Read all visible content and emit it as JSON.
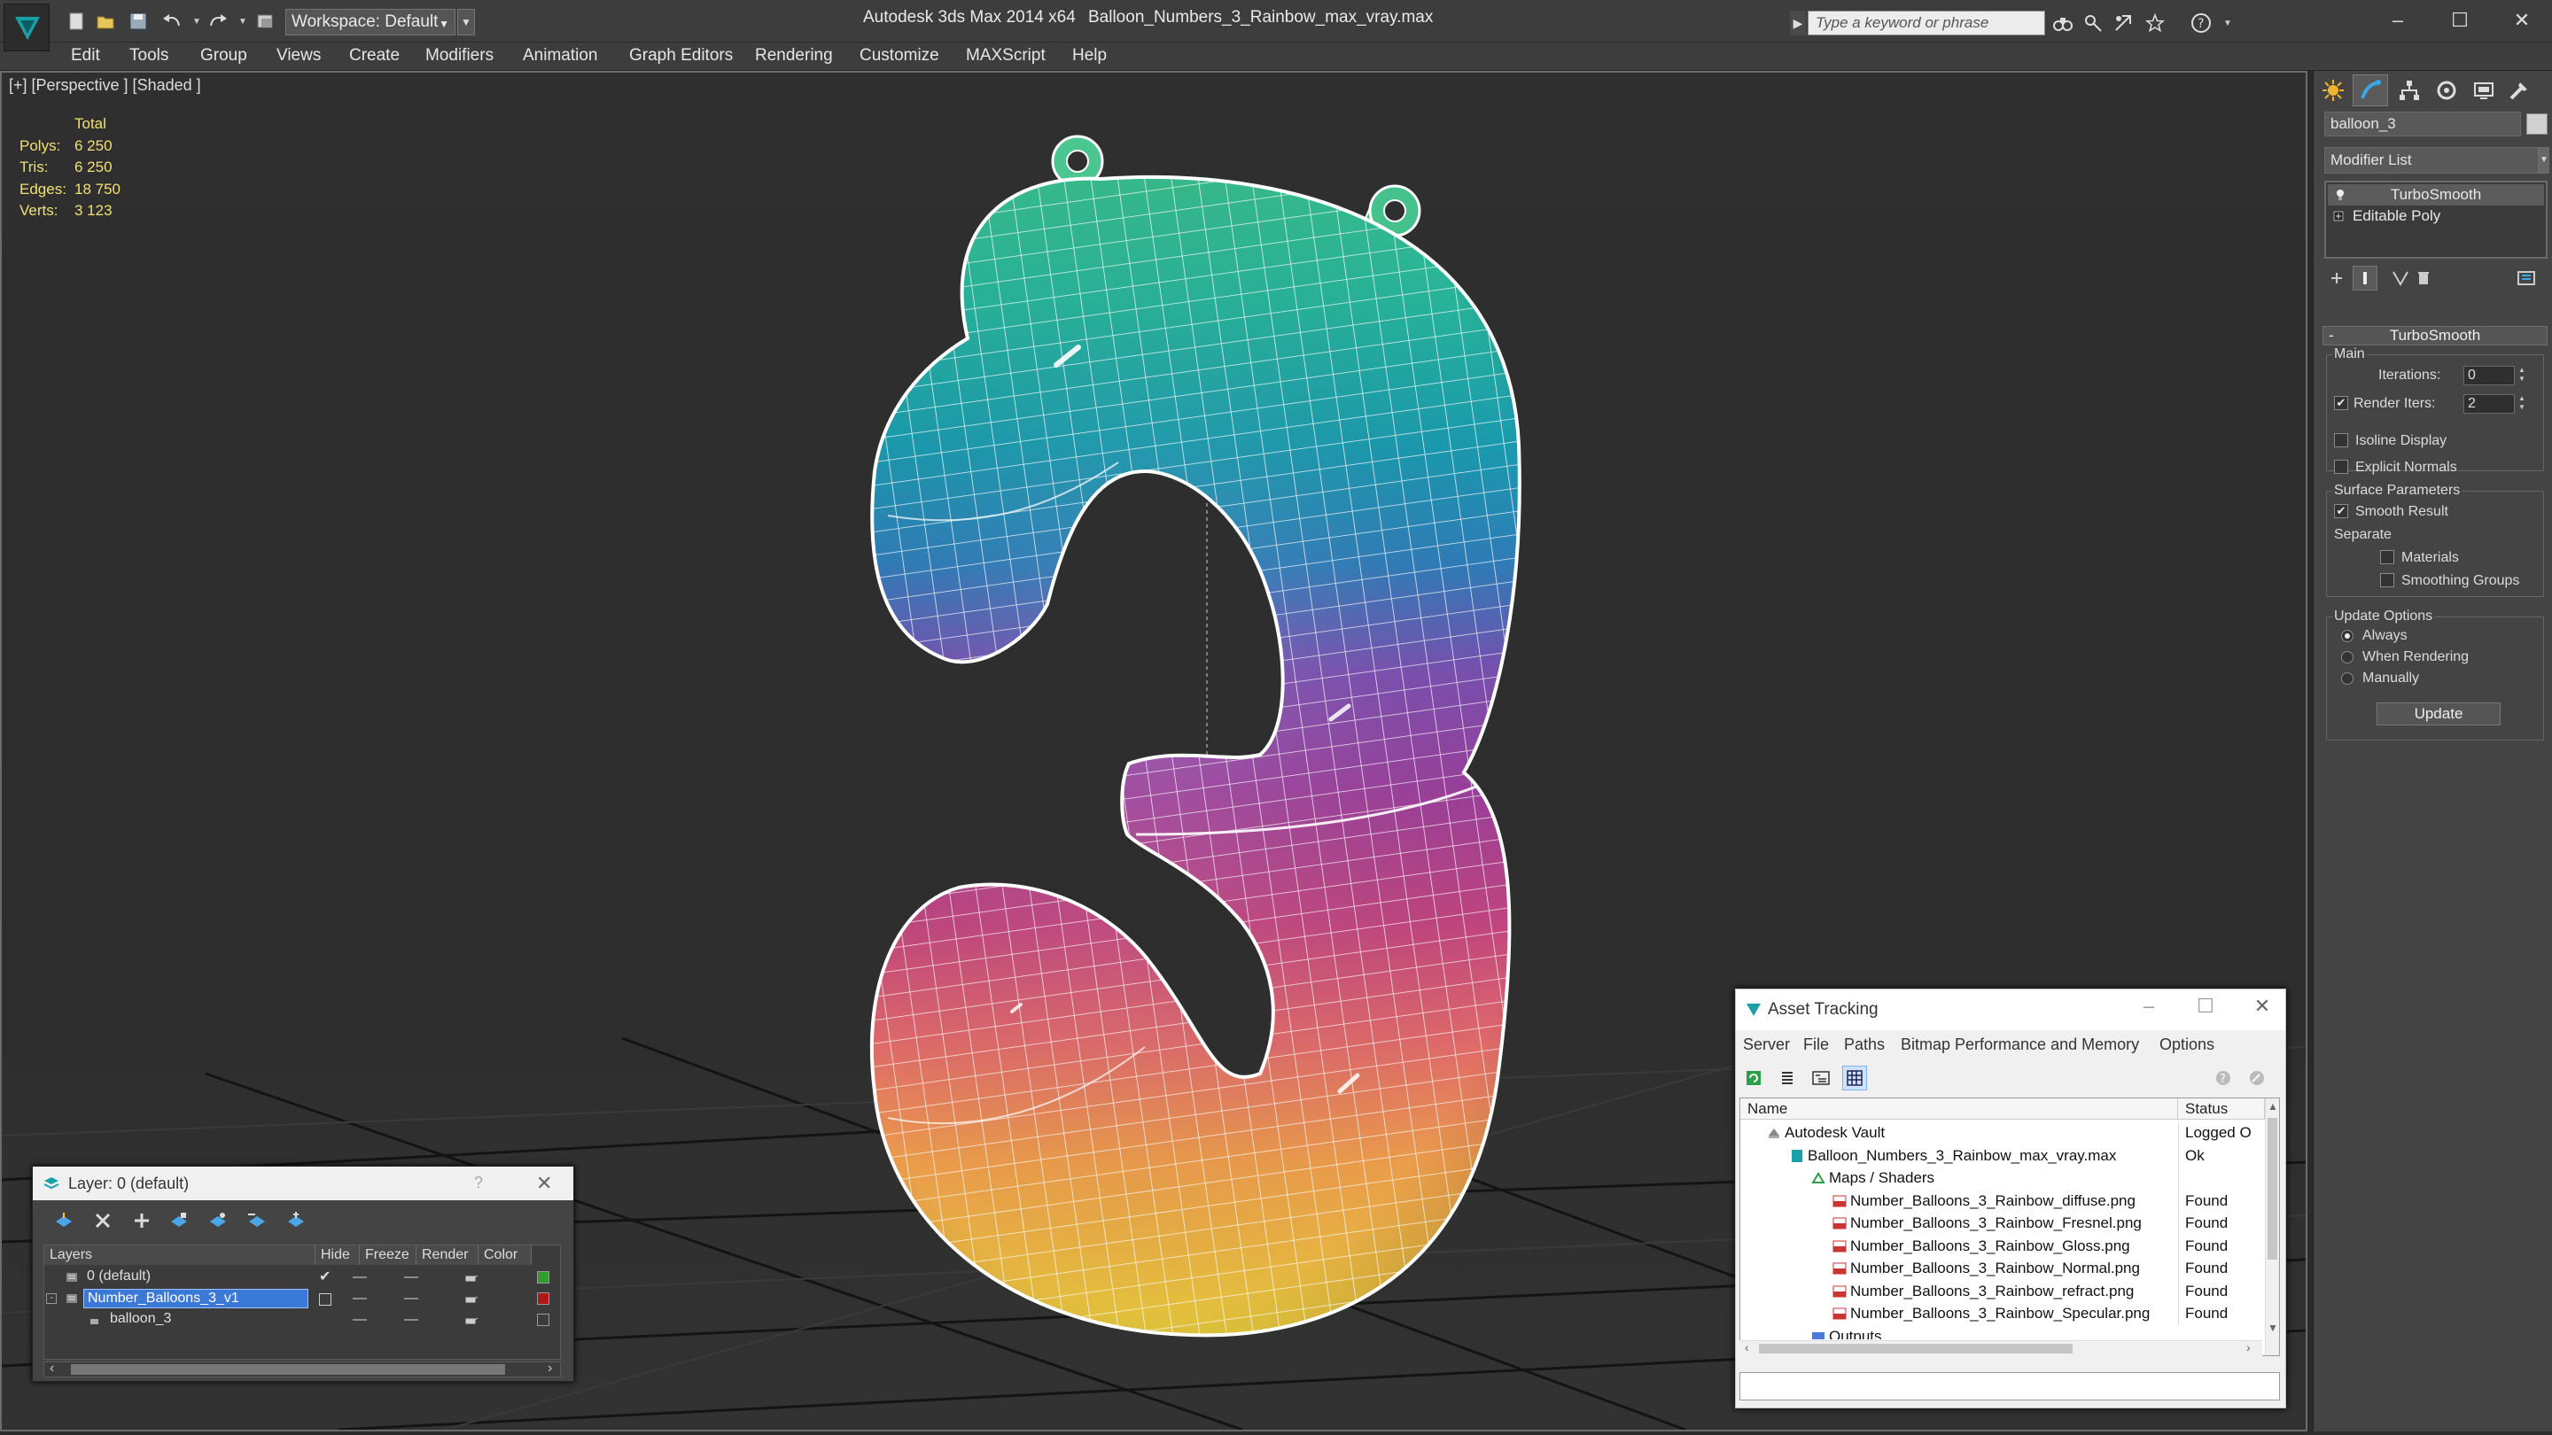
{
  "titlebar": {
    "workspace": "Workspace: Default",
    "app_title": "Autodesk 3ds Max  2014 x64",
    "file_title": "Balloon_Numbers_3_Rainbow_max_vray.max",
    "search_placeholder": "Type a keyword or phrase",
    "win_minimize": "–",
    "win_maximize": "☐",
    "win_close": "✕"
  },
  "menubar": {
    "items": [
      "Edit",
      "Tools",
      "Group",
      "Views",
      "Create",
      "Modifiers",
      "Animation",
      "Graph Editors",
      "Rendering",
      "Customize",
      "MAXScript",
      "Help"
    ]
  },
  "viewport": {
    "label": "[+] [Perspective ] [Shaded ]",
    "stats": {
      "header": "Total",
      "polys_label": "Polys:",
      "polys": "6 250",
      "tris_label": "Tris:",
      "tris": "6 250",
      "edges_label": "Edges:",
      "edges": "18 750",
      "verts_label": "Verts:",
      "verts": "3 123"
    }
  },
  "command_panel": {
    "object_name": "balloon_3",
    "modifier_list": "Modifier List",
    "stack": [
      "TurboSmooth",
      "Editable Poly"
    ],
    "rollout_title": "TurboSmooth",
    "main_group": "Main",
    "iterations_label": "Iterations:",
    "iterations": "0",
    "render_iters_label": "Render Iters:",
    "render_iters": "2",
    "render_iters_checked": true,
    "isoline_label": "Isoline Display",
    "explicit_normals_label": "Explicit Normals",
    "surface_group": "Surface Parameters",
    "smooth_result_label": "Smooth Result",
    "separate_label": "Separate",
    "materials_label": "Materials",
    "smoothing_groups_label": "Smoothing Groups",
    "update_group": "Update Options",
    "always_label": "Always",
    "when_rendering_label": "When Rendering",
    "manually_label": "Manually",
    "update_button": "Update",
    "check_mark": "✔"
  },
  "layer_window": {
    "title": "Layer: 0 (default)",
    "help": "?",
    "close": "✕",
    "columns": [
      "Layers",
      "Hide",
      "Freeze",
      "Render",
      "Color"
    ],
    "rows": [
      {
        "name": "0 (default)",
        "color": "#2f9e2f"
      },
      {
        "name": "Number_Balloons_3_v1",
        "color": "#b01818"
      },
      {
        "name": "balloon_3",
        "color": "#3b3b3b"
      }
    ]
  },
  "asset_window": {
    "title": "Asset Tracking",
    "menu": [
      "Server",
      "File",
      "Paths",
      "Bitmap Performance and Memory",
      "Options"
    ],
    "columns": [
      "Name",
      "Status"
    ],
    "rows": [
      {
        "name": "Autodesk Vault",
        "status": "Logged O"
      },
      {
        "name": "Balloon_Numbers_3_Rainbow_max_vray.max",
        "status": "Ok"
      },
      {
        "name": "Maps / Shaders",
        "status": ""
      },
      {
        "name": "Number_Balloons_3_Rainbow_diffuse.png",
        "status": "Found"
      },
      {
        "name": "Number_Balloons_3_Rainbow_Fresnel.png",
        "status": "Found"
      },
      {
        "name": "Number_Balloons_3_Rainbow_Gloss.png",
        "status": "Found"
      },
      {
        "name": "Number_Balloons_3_Rainbow_Normal.png",
        "status": "Found"
      },
      {
        "name": "Number_Balloons_3_Rainbow_refract.png",
        "status": "Found"
      },
      {
        "name": "Number_Balloons_3_Rainbow_Specular.png",
        "status": "Found"
      },
      {
        "name": "Outputs",
        "status": ""
      }
    ]
  }
}
